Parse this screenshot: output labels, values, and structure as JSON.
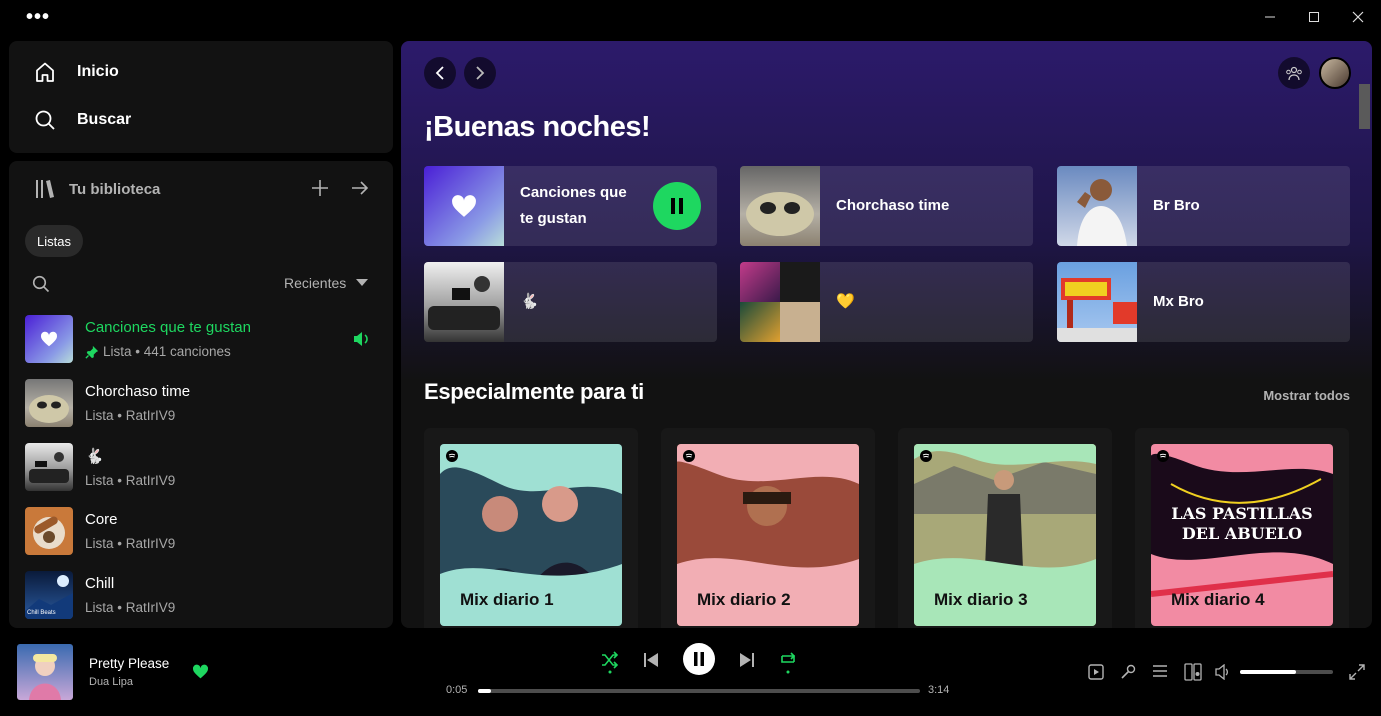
{
  "window": {
    "menu_icon": "more-dots-icon",
    "controls": [
      "minimize-icon",
      "maximize-icon",
      "close-icon"
    ]
  },
  "nav": {
    "home_label": "Inicio",
    "search_label": "Buscar"
  },
  "library": {
    "title": "Tu biblioteca",
    "filter_chip": "Listas",
    "sort_label": "Recientes",
    "items": [
      {
        "title": "Canciones que te gustan",
        "subtitle": "Lista • 441 canciones",
        "active": true,
        "pinned": true,
        "playing": true
      },
      {
        "title": "Chorchaso time",
        "subtitle": "Lista • RatIrIV9"
      },
      {
        "title": "🐇",
        "subtitle": "Lista • RatIrIV9"
      },
      {
        "title": "Core",
        "subtitle": "Lista • RatIrIV9"
      },
      {
        "title": "Chill",
        "subtitle": "Lista • RatIrIV9",
        "thumb_text": "Chill Beats"
      }
    ]
  },
  "main": {
    "greeting": "¡Buenas noches!",
    "shortcuts": [
      {
        "label": "Canciones que te gustan",
        "playing": true
      },
      {
        "label": "Chorchaso time"
      },
      {
        "label": "Br Bro"
      },
      {
        "label": "🐇"
      },
      {
        "label": "💛"
      },
      {
        "label": "Mx Bro"
      }
    ],
    "section_title": "Especialmente para ti",
    "show_all": "Mostrar todos",
    "mixes": [
      {
        "title": "Mix diario 1",
        "color": "#9fe0d3"
      },
      {
        "title": "Mix diario 2",
        "color": "#f2aeb4"
      },
      {
        "title": "Mix diario 3",
        "color": "#a8e6b8"
      },
      {
        "title": "Mix diario 4",
        "color": "#f28ba3",
        "art_text": "LAS PASTILLAS DEL ABUELO"
      }
    ]
  },
  "player": {
    "track": "Pretty Please",
    "artist": "Dua Lipa",
    "elapsed": "0:05",
    "duration": "3:14",
    "progress": 0.03,
    "volume": 0.6
  },
  "colors": {
    "accent": "#1ed760",
    "bg": "#000000",
    "panel": "#121212"
  }
}
